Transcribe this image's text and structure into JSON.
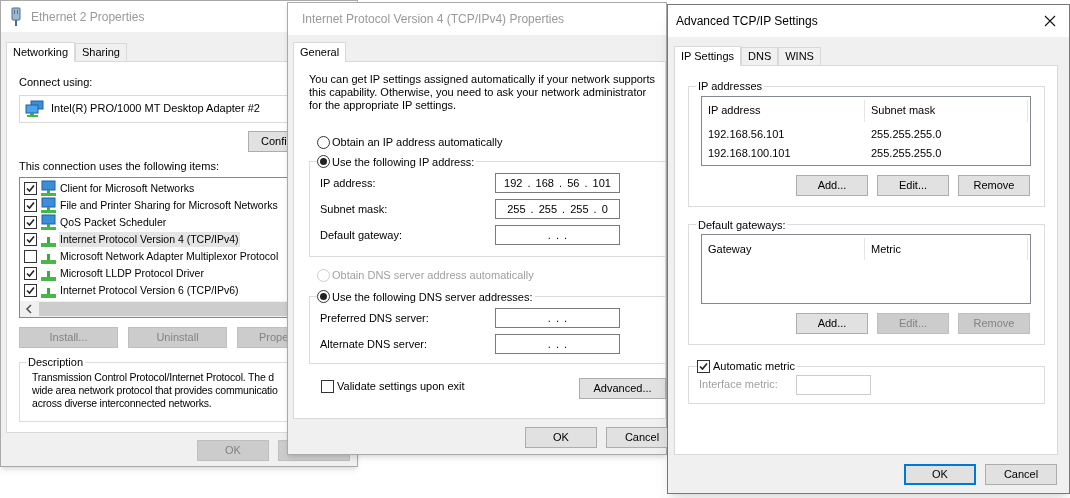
{
  "ethernet_properties": {
    "title": "Ethernet 2 Properties",
    "active": false,
    "tabs": [
      {
        "label": "Networking",
        "selected": true
      },
      {
        "label": "Sharing",
        "selected": false
      }
    ],
    "connect_using_label": "Connect using:",
    "adapter": "Intel(R) PRO/1000 MT Desktop Adapter #2",
    "configure_button": "Confi",
    "items_label": "This connection uses the following items:",
    "items": [
      {
        "label": "Client for Microsoft Networks",
        "checked": true,
        "selected": false,
        "kind": "client"
      },
      {
        "label": "File and Printer Sharing for Microsoft Networks",
        "checked": true,
        "selected": false,
        "kind": "service"
      },
      {
        "label": "QoS Packet Scheduler",
        "checked": true,
        "selected": false,
        "kind": "service"
      },
      {
        "label": "Internet Protocol Version 4 (TCP/IPv4)",
        "checked": true,
        "selected": true,
        "kind": "protocol"
      },
      {
        "label": "Microsoft Network Adapter Multiplexor Protocol",
        "checked": false,
        "selected": false,
        "kind": "protocol"
      },
      {
        "label": "Microsoft LLDP Protocol Driver",
        "checked": true,
        "selected": false,
        "kind": "protocol"
      },
      {
        "label": "Internet Protocol Version 6 (TCP/IPv6)",
        "checked": true,
        "selected": false,
        "kind": "protocol"
      }
    ],
    "buttons": [
      {
        "label": "Install...",
        "disabled": true
      },
      {
        "label": "Uninstall",
        "disabled": true
      },
      {
        "label": "Prope",
        "disabled": true
      }
    ],
    "description": {
      "title": "Description",
      "lines": [
        "Transmission Control Protocol/Internet Protocol. The d",
        "wide area network protocol that provides communicatio",
        "across diverse interconnected networks."
      ]
    },
    "footer_buttons": [
      {
        "label": "OK",
        "disabled": true
      }
    ]
  },
  "ipv4_properties": {
    "title": "Internet Protocol Version 4 (TCP/IPv4) Properties",
    "active": false,
    "tabs": [
      {
        "label": "General",
        "selected": true
      }
    ],
    "intro": "You can get IP settings assigned automatically if your network supports this capability. Otherwise, you need to ask your network administrator for the appropriate IP settings.",
    "ip_mode": [
      {
        "label": "Obtain an IP address automatically",
        "selected": false,
        "disabled": false
      },
      {
        "label": "Use the following IP address:",
        "selected": true,
        "disabled": false
      }
    ],
    "ip_fields": [
      {
        "label": "IP address:",
        "value": "192 . 168 . 56 . 101"
      },
      {
        "label": "Subnet mask:",
        "value": "255 . 255 . 255 . 0"
      },
      {
        "label": "Default gateway:",
        "value": ". . ."
      }
    ],
    "dns_mode": [
      {
        "label": "Obtain DNS server address automatically",
        "selected": false,
        "disabled": true
      },
      {
        "label": "Use the following DNS server addresses:",
        "selected": true,
        "disabled": false
      }
    ],
    "dns_fields": [
      {
        "label": "Preferred DNS server:",
        "value": ". . ."
      },
      {
        "label": "Alternate DNS server:",
        "value": ". . ."
      }
    ],
    "validate": {
      "label": "Validate settings upon exit",
      "checked": false
    },
    "advanced_button": "Advanced...",
    "footer_buttons": [
      {
        "label": "OK"
      },
      {
        "label": "Cancel"
      }
    ]
  },
  "advanced_settings": {
    "title": "Advanced TCP/IP Settings",
    "active": true,
    "tabs": [
      {
        "label": "IP Settings",
        "selected": true
      },
      {
        "label": "DNS",
        "selected": false
      },
      {
        "label": "WINS",
        "selected": false
      }
    ],
    "ip_addresses": {
      "title": "IP addresses",
      "columns": [
        "IP address",
        "Subnet mask"
      ],
      "rows": [
        [
          "192.168.56.101",
          "255.255.255.0"
        ],
        [
          "192.168.100.101",
          "255.255.255.0"
        ]
      ],
      "buttons": [
        {
          "label": "Add...",
          "disabled": false
        },
        {
          "label": "Edit...",
          "disabled": false
        },
        {
          "label": "Remove",
          "disabled": false
        }
      ]
    },
    "default_gateways": {
      "title": "Default gateways:",
      "columns": [
        "Gateway",
        "Metric"
      ],
      "buttons": [
        {
          "label": "Add...",
          "disabled": false
        },
        {
          "label": "Edit...",
          "disabled": true
        },
        {
          "label": "Remove",
          "disabled": true
        }
      ]
    },
    "automatic_metric": {
      "label": "Automatic metric",
      "checked": true
    },
    "interface_metric": {
      "label": "Interface metric:",
      "disabled": true
    },
    "footer_buttons": [
      {
        "label": "OK",
        "focused": true
      },
      {
        "label": "Cancel",
        "focused": false
      }
    ]
  }
}
